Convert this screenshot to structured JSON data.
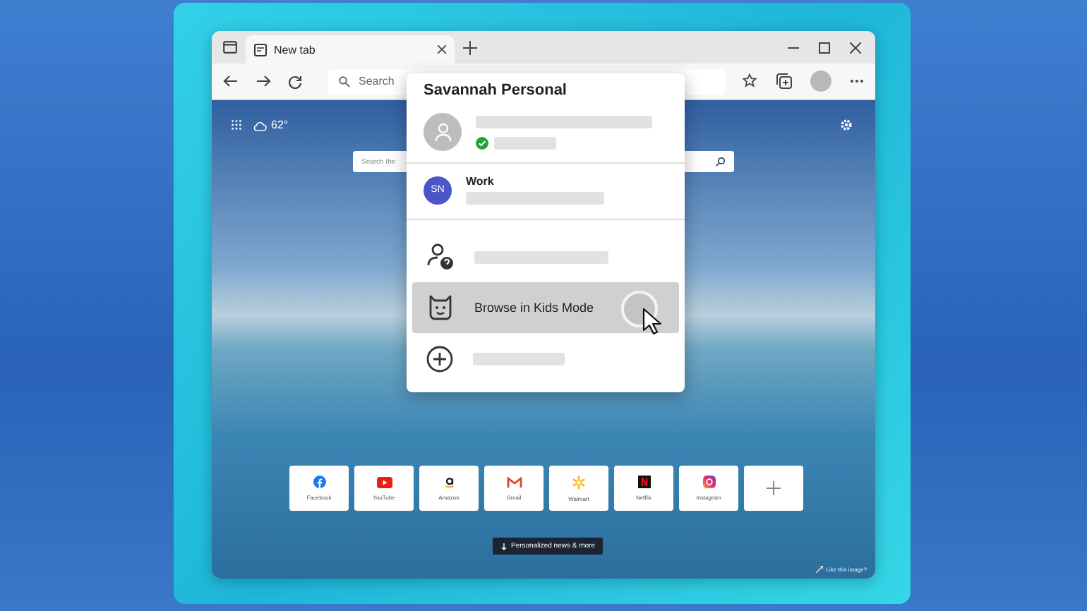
{
  "window": {
    "tab": {
      "title": "New tab",
      "selected": true
    }
  },
  "toolbar": {
    "search_placeholder": "Search"
  },
  "new_tab_page": {
    "weather": "62°",
    "search_placeholder": "Search the",
    "quick_links": [
      {
        "kind": "facebook",
        "label": "Facebook"
      },
      {
        "kind": "youtube",
        "label": "YouTube"
      },
      {
        "kind": "amazon",
        "label": "Amazon"
      },
      {
        "kind": "gmail",
        "label": "Gmail"
      },
      {
        "kind": "walmart",
        "label": "Walmart"
      },
      {
        "kind": "netflix",
        "label": "Netflix"
      },
      {
        "kind": "instagram",
        "label": "Instagram"
      },
      {
        "kind": "add"
      }
    ],
    "news_button": "Personalized news & more",
    "image_credit": "Like this image?"
  },
  "profile_menu": {
    "title": "Savannah Personal",
    "accounts": [
      {
        "kind": "personal",
        "signed_in": true
      },
      {
        "kind": "work",
        "initials": "SN",
        "name": "Work"
      }
    ],
    "actions": [
      {
        "kind": "guest",
        "selected": false
      },
      {
        "kind": "kids",
        "label": "Browse in Kids Mode",
        "selected": true
      },
      {
        "kind": "add",
        "selected": false
      }
    ]
  }
}
